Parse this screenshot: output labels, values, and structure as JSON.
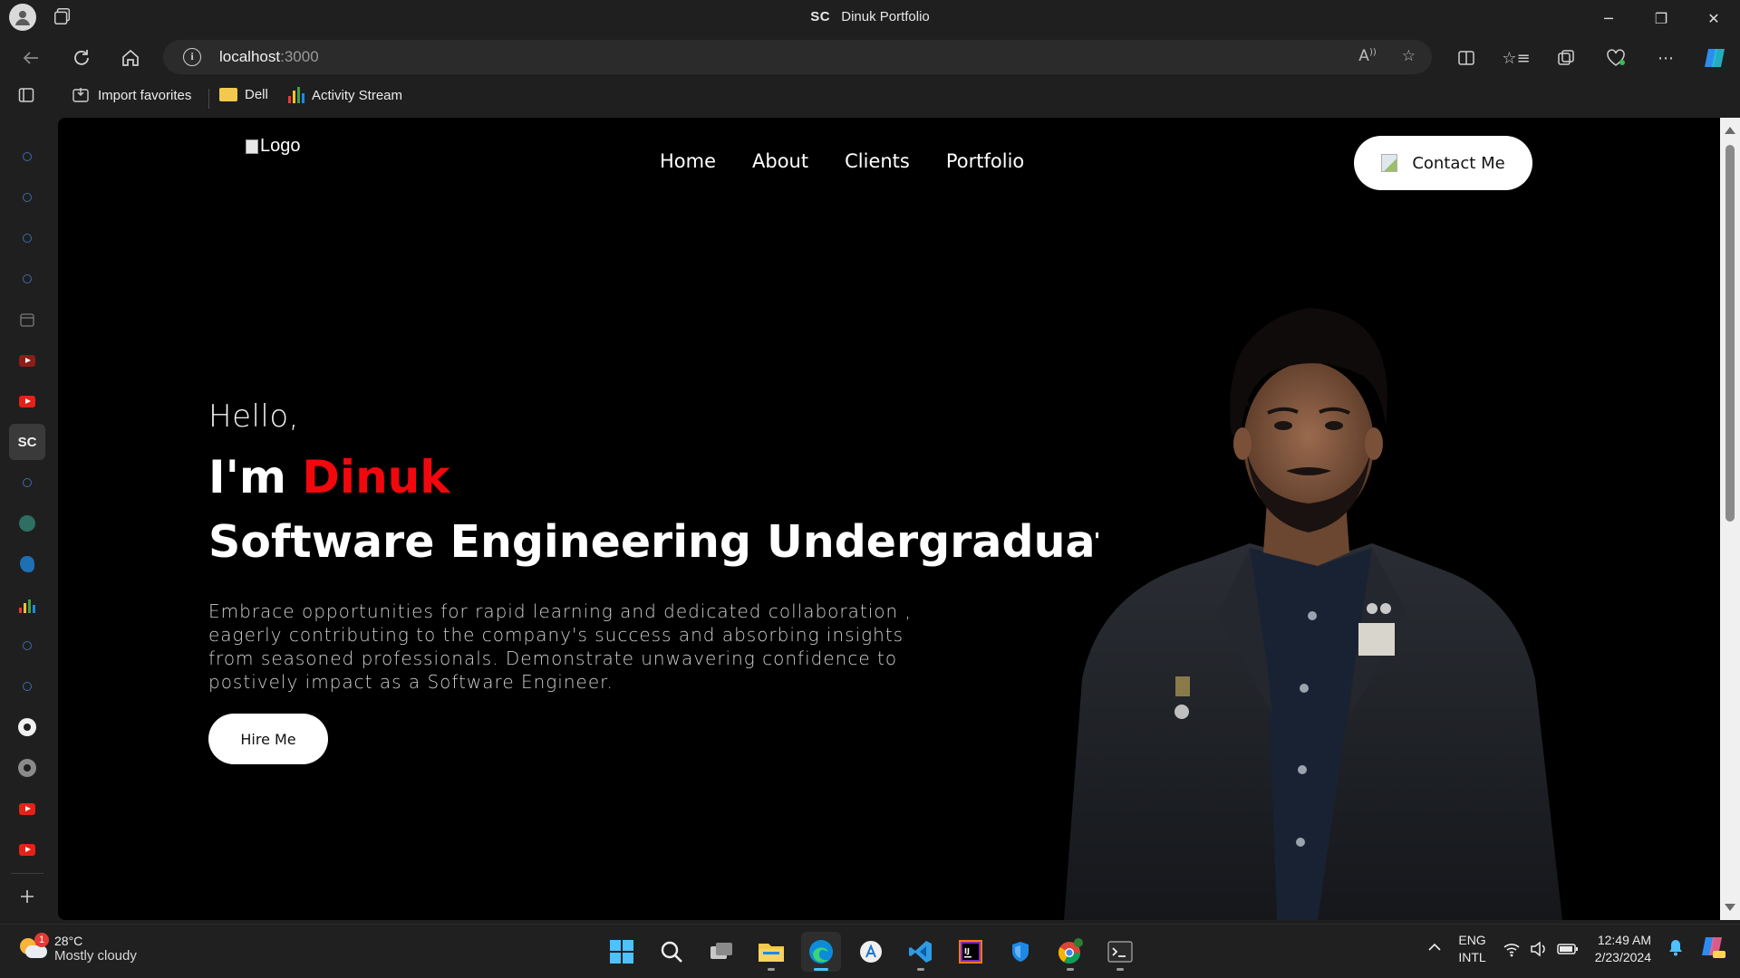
{
  "window": {
    "favicon_text": "SC",
    "title": "Dinuk Portfolio",
    "minimize": "─",
    "restore": "❐",
    "close": "✕"
  },
  "address_bar": {
    "host": "localhost",
    "port": ":3000"
  },
  "favorites": {
    "import_label": "Import favorites",
    "dell_label": "Dell",
    "activity_label": "Activity Stream"
  },
  "sidebar": {
    "active_tab_label": "SC"
  },
  "page": {
    "logo_alt": "Logo",
    "nav": [
      "Home",
      "About",
      "Clients",
      "Portfolio"
    ],
    "contact_label": "Contact Me",
    "hello": "Hello,",
    "im_prefix": "I'm ",
    "name": "Dinuk",
    "role": "Software Engineering Undergraduate",
    "description": "Embrace opportunities for rapid learning and dedicated collaboration , eagerly contributing to the company's success and absorbing insights from seasoned professionals. Demonstrate unwavering confidence to postively impact as a Software Engineer.",
    "hire_label": "Hire Me",
    "name_color": "#f2070d"
  },
  "taskbar": {
    "weather_badge": "1",
    "temperature": "28°C",
    "condition": "Mostly cloudy",
    "lang_top": "ENG",
    "lang_bottom": "INTL",
    "time": "12:49 AM",
    "date": "2/23/2024"
  }
}
